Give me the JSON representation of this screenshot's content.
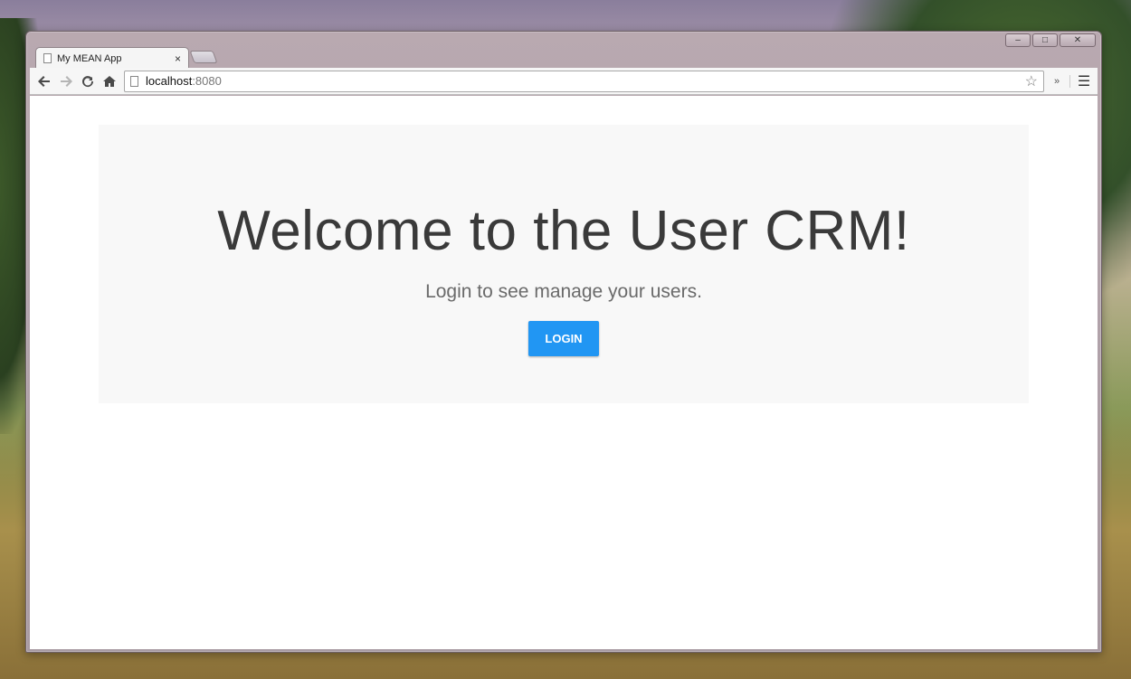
{
  "browser": {
    "tab_title": "My MEAN App",
    "tab_close": "×",
    "url_host": "localhost",
    "url_port": ":8080",
    "window_controls": {
      "minimize": "–",
      "maximize": "□",
      "close": "✕"
    },
    "icons": {
      "back": "back-arrow-icon",
      "forward": "forward-arrow-icon",
      "reload": "reload-icon",
      "home": "home-icon",
      "star": "bookmark-star-icon",
      "extensions": "extensions-chevron-icon",
      "menu": "hamburger-menu-icon"
    }
  },
  "page": {
    "heading": "Welcome to the User CRM!",
    "subtitle": "Login to see manage your users.",
    "login_label": "LOGIN",
    "button_color": "#2196f3"
  }
}
